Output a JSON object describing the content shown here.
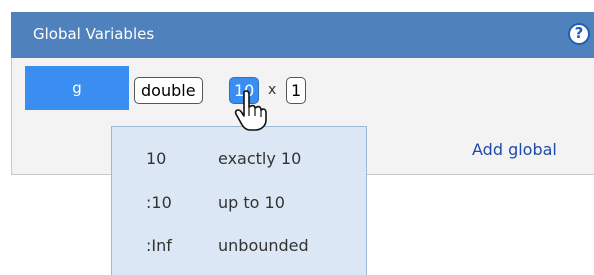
{
  "header": {
    "title": "Global Variables",
    "help_icon": "help-icon"
  },
  "variable": {
    "name": "g",
    "type": "double",
    "dim1": "10",
    "times": "x",
    "dim2": "1"
  },
  "actions": {
    "add_global": "Add global"
  },
  "size_menu": {
    "options": [
      {
        "value": "10",
        "description": "exactly 10"
      },
      {
        "value": ":10",
        "description": "up to 10"
      },
      {
        "value": ":Inf",
        "description": "unbounded"
      }
    ]
  },
  "colors": {
    "header": "#4f81bd",
    "selection": "#3a8ef2",
    "dropdown": "#dbe7f4",
    "link": "#1f4aa8"
  }
}
